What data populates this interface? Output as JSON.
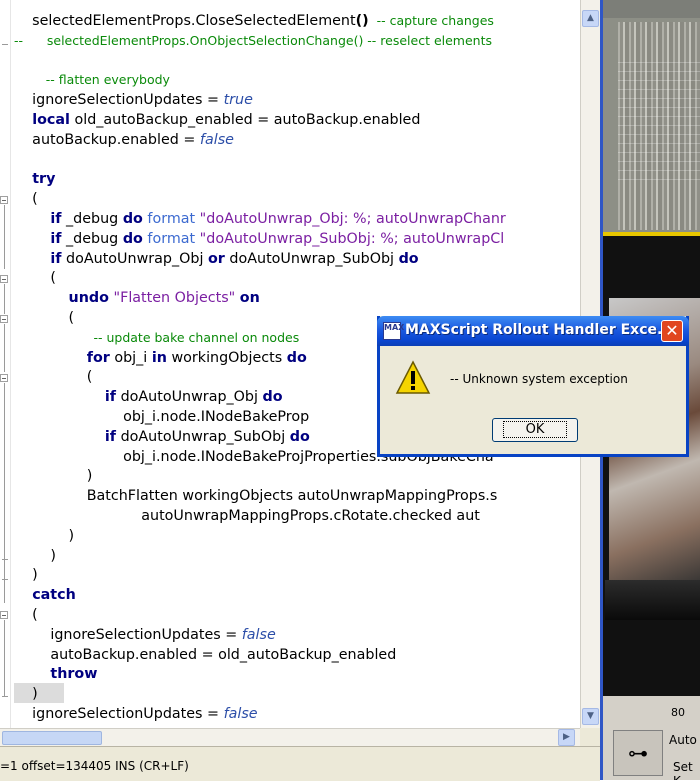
{
  "editor": {
    "lines": [
      {
        "prefix": "",
        "segs": [
          [
            "",
            "    selectedElementProps.CloseSelectedElement"
          ],
          [
            "bd",
            "()"
          ],
          [
            "cm",
            "  -- capture changes"
          ]
        ]
      },
      {
        "prefix": "",
        "segs": [
          [
            "cm",
            "--      selectedElementProps.OnObjectSelectionChange() -- reselect elements"
          ]
        ]
      },
      {
        "prefix": "",
        "segs": []
      },
      {
        "prefix": "",
        "segs": [
          [
            "cm",
            "        -- flatten everybody"
          ]
        ]
      },
      {
        "prefix": "",
        "segs": [
          [
            "",
            "    ignoreSelectionUpdates = "
          ],
          [
            "it",
            "true"
          ]
        ]
      },
      {
        "prefix": "",
        "segs": [
          [
            "",
            "    "
          ],
          [
            "kw",
            "local"
          ],
          [
            "",
            " old_autoBackup_enabled = autoBackup.enabled"
          ]
        ]
      },
      {
        "prefix": "",
        "segs": [
          [
            "",
            "    autoBackup.enabled = "
          ],
          [
            "it",
            "false"
          ]
        ]
      },
      {
        "prefix": "",
        "segs": []
      },
      {
        "prefix": "",
        "segs": [
          [
            "",
            "    "
          ],
          [
            "kw",
            "try"
          ]
        ]
      },
      {
        "prefix": "",
        "segs": [
          [
            "",
            "    ("
          ]
        ]
      },
      {
        "prefix": "",
        "segs": [
          [
            "",
            "        "
          ],
          [
            "kw",
            "if"
          ],
          [
            "",
            " _debug "
          ],
          [
            "kw",
            "do"
          ],
          [
            "",
            " "
          ],
          [
            "fn",
            "format"
          ],
          [
            "",
            " "
          ],
          [
            "str",
            "\"doAutoUnwrap_Obj: %; autoUnwrapChanr"
          ]
        ]
      },
      {
        "prefix": "",
        "segs": [
          [
            "",
            "        "
          ],
          [
            "kw",
            "if"
          ],
          [
            "",
            " _debug "
          ],
          [
            "kw",
            "do"
          ],
          [
            "",
            " "
          ],
          [
            "fn",
            "format"
          ],
          [
            "",
            " "
          ],
          [
            "str",
            "\"doAutoUnwrap_SubObj: %; autoUnwrapCl"
          ]
        ]
      },
      {
        "prefix": "",
        "segs": [
          [
            "",
            "        "
          ],
          [
            "kw",
            "if"
          ],
          [
            "",
            " doAutoUnwrap_Obj "
          ],
          [
            "kw",
            "or"
          ],
          [
            "",
            " doAutoUnwrap_SubObj "
          ],
          [
            "kw",
            "do"
          ]
        ]
      },
      {
        "prefix": "",
        "segs": [
          [
            "",
            "        ("
          ]
        ]
      },
      {
        "prefix": "",
        "segs": [
          [
            "",
            "            "
          ],
          [
            "kw",
            "undo"
          ],
          [
            "",
            " "
          ],
          [
            "str",
            "\"Flatten Objects\""
          ],
          [
            "",
            " "
          ],
          [
            "kw",
            "on"
          ]
        ]
      },
      {
        "prefix": "",
        "segs": [
          [
            "",
            "            ("
          ]
        ]
      },
      {
        "prefix": "",
        "segs": [
          [
            "cm",
            "                    -- update bake channel on nodes"
          ]
        ]
      },
      {
        "prefix": "",
        "segs": [
          [
            "",
            "                "
          ],
          [
            "kw",
            "for"
          ],
          [
            "",
            " obj_i "
          ],
          [
            "kw",
            "in"
          ],
          [
            "",
            " workingObjects "
          ],
          [
            "kw",
            "do"
          ]
        ]
      },
      {
        "prefix": "",
        "segs": [
          [
            "",
            "                ("
          ]
        ]
      },
      {
        "prefix": "",
        "segs": [
          [
            "",
            "                    "
          ],
          [
            "kw",
            "if"
          ],
          [
            "",
            " doAutoUnwrap_Obj "
          ],
          [
            "kw",
            "do"
          ]
        ]
      },
      {
        "prefix": "",
        "segs": [
          [
            "",
            "                        obj_i.node.INodeBakeProp"
          ]
        ]
      },
      {
        "prefix": "",
        "segs": [
          [
            "",
            "                    "
          ],
          [
            "kw",
            "if"
          ],
          [
            "",
            " doAutoUnwrap_SubObj "
          ],
          [
            "kw",
            "do"
          ]
        ]
      },
      {
        "prefix": "",
        "segs": [
          [
            "",
            "                        obj_i.node.INodeBakeProjProperties.subObjBakeCha"
          ]
        ]
      },
      {
        "prefix": "",
        "segs": [
          [
            "",
            "                )"
          ]
        ]
      },
      {
        "prefix": "",
        "segs": [
          [
            "",
            "                BatchFlatten workingObjects autoUnwrapMappingProps.s"
          ]
        ]
      },
      {
        "prefix": "",
        "segs": [
          [
            "",
            "                            autoUnwrapMappingProps.cRotate.checked aut"
          ]
        ]
      },
      {
        "prefix": "",
        "segs": [
          [
            "",
            "            )"
          ]
        ]
      },
      {
        "prefix": "",
        "segs": [
          [
            "",
            "        )"
          ]
        ]
      },
      {
        "prefix": "",
        "segs": [
          [
            "",
            "    )"
          ]
        ]
      },
      {
        "prefix": "",
        "segs": [
          [
            "",
            "    "
          ],
          [
            "kw",
            "catch"
          ]
        ]
      },
      {
        "prefix": "",
        "segs": [
          [
            "",
            "    ("
          ]
        ]
      },
      {
        "prefix": "",
        "segs": [
          [
            "",
            "        ignoreSelectionUpdates = "
          ],
          [
            "it",
            "false"
          ]
        ]
      },
      {
        "prefix": "",
        "segs": [
          [
            "",
            "        autoBackup.enabled = old_autoBackup_enabled"
          ]
        ]
      },
      {
        "prefix": "",
        "segs": [
          [
            "",
            "        "
          ],
          [
            "kw",
            "throw"
          ]
        ]
      },
      {
        "prefix": "",
        "segs": [
          [
            "",
            "    )"
          ]
        ]
      },
      {
        "prefix": "",
        "segs": [
          [
            "",
            "    ignoreSelectionUpdates = "
          ],
          [
            "it",
            "false"
          ]
        ]
      }
    ]
  },
  "status_bar": {
    "text": "=1 offset=134405 INS (CR+LF)"
  },
  "viewport": {
    "timeline_value": "80",
    "auto_label": "Auto",
    "set_key_label": "Set K",
    "key_icon": "key-icon"
  },
  "dialog": {
    "title": "MAXScript Rollout Handler Exce...",
    "message": "-- Unknown system exception",
    "ok_label": "OK",
    "icon": "warning-icon",
    "app_icon_text": "MAX",
    "close_glyph": "✕"
  },
  "colors": {
    "keyword": "#000080",
    "comment": "#0a8a0a",
    "string": "#7b1fa2",
    "literal": "#2c4ea8",
    "titlebar": "#0a46d2"
  }
}
